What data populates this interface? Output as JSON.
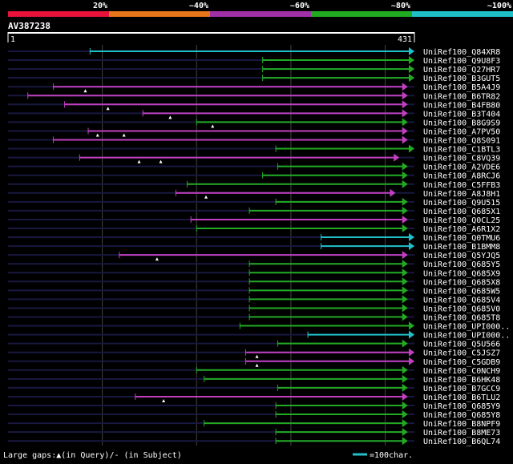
{
  "identity_scale": {
    "labels": [
      "20%",
      "~40%",
      "~60%",
      "~80%",
      "~100%"
    ],
    "colors": [
      "#e8123a",
      "#e8761a",
      "#a030a8",
      "#22aa22",
      "#20c0c8"
    ]
  },
  "query": {
    "id": "AV387238",
    "length": 431,
    "start_label": "1",
    "end_label": "431"
  },
  "color_key": {
    "magenta": "#c040c0",
    "green": "#22aa22",
    "cyan": "#20c0c8",
    "background_line": "#181840",
    "gridline": "#444444"
  },
  "alignments": [
    {
      "label": "UniRef100_Q84XR8",
      "start": 87,
      "end": 431,
      "color": "cyan",
      "marks": []
    },
    {
      "label": "UniRef100_Q9U8F3",
      "start": 270,
      "end": 431,
      "color": "green",
      "marks": []
    },
    {
      "label": "UniRef100_Q27HR7",
      "start": 270,
      "end": 431,
      "color": "green",
      "marks": []
    },
    {
      "label": "UniRef100_B3GUT5",
      "start": 270,
      "end": 431,
      "color": "green",
      "marks": []
    },
    {
      "label": "UniRef100_B5A4J9",
      "start": 48,
      "end": 424,
      "color": "magenta",
      "marks": [
        82
      ]
    },
    {
      "label": "UniRef100_B6TR82",
      "start": 21,
      "end": 424,
      "color": "magenta",
      "marks": []
    },
    {
      "label": "UniRef100_B4FB80",
      "start": 60,
      "end": 424,
      "color": "magenta",
      "marks": [
        106
      ]
    },
    {
      "label": "UniRef100_B3T404",
      "start": 143,
      "end": 424,
      "color": "magenta",
      "marks": [
        172
      ]
    },
    {
      "label": "UniRef100_B8G9S9",
      "start": 200,
      "end": 424,
      "color": "green",
      "marks": [
        217
      ]
    },
    {
      "label": "UniRef100_A7PV50",
      "start": 85,
      "end": 424,
      "color": "magenta",
      "marks": [
        95,
        123
      ]
    },
    {
      "label": "UniRef100_Q8S091",
      "start": 48,
      "end": 424,
      "color": "magenta",
      "marks": []
    },
    {
      "label": "UniRef100_C1BTL3",
      "start": 284,
      "end": 431,
      "color": "green",
      "marks": []
    },
    {
      "label": "UniRef100_C8VQ39",
      "start": 76,
      "end": 415,
      "color": "magenta",
      "marks": [
        139,
        162
      ]
    },
    {
      "label": "UniRef100_A2VDE6",
      "start": 286,
      "end": 424,
      "color": "green",
      "marks": []
    },
    {
      "label": "UniRef100_A8RCJ6",
      "start": 270,
      "end": 424,
      "color": "green",
      "marks": []
    },
    {
      "label": "UniRef100_C5FFB3",
      "start": 190,
      "end": 424,
      "color": "green",
      "marks": []
    },
    {
      "label": "UniRef100_A8J8H1",
      "start": 178,
      "end": 411,
      "color": "magenta",
      "marks": [
        210
      ]
    },
    {
      "label": "UniRef100_Q9U515",
      "start": 284,
      "end": 424,
      "color": "green",
      "marks": []
    },
    {
      "label": "UniRef100_Q685X1",
      "start": 256,
      "end": 424,
      "color": "green",
      "marks": []
    },
    {
      "label": "UniRef100_Q0CL25",
      "start": 194,
      "end": 424,
      "color": "magenta",
      "marks": []
    },
    {
      "label": "UniRef100_A6R1X2",
      "start": 200,
      "end": 424,
      "color": "green",
      "marks": []
    },
    {
      "label": "UniRef100_Q0TMU6",
      "start": 332,
      "end": 431,
      "color": "cyan",
      "marks": []
    },
    {
      "label": "UniRef100_B1BMM8",
      "start": 332,
      "end": 431,
      "color": "cyan",
      "marks": []
    },
    {
      "label": "UniRef100_Q5YJQ5",
      "start": 118,
      "end": 424,
      "color": "magenta",
      "marks": [
        158
      ]
    },
    {
      "label": "UniRef100_Q685Y5",
      "start": 256,
      "end": 424,
      "color": "green",
      "marks": []
    },
    {
      "label": "UniRef100_Q685X9",
      "start": 256,
      "end": 424,
      "color": "green",
      "marks": []
    },
    {
      "label": "UniRef100_Q685X8",
      "start": 256,
      "end": 424,
      "color": "green",
      "marks": []
    },
    {
      "label": "UniRef100_Q685W5",
      "start": 256,
      "end": 424,
      "color": "green",
      "marks": []
    },
    {
      "label": "UniRef100_Q685V4",
      "start": 256,
      "end": 424,
      "color": "green",
      "marks": []
    },
    {
      "label": "UniRef100_Q685V0",
      "start": 256,
      "end": 424,
      "color": "green",
      "marks": []
    },
    {
      "label": "UniRef100_Q685T8",
      "start": 256,
      "end": 424,
      "color": "green",
      "marks": []
    },
    {
      "label": "UniRef100_UPI000..",
      "start": 246,
      "end": 431,
      "color": "green",
      "marks": []
    },
    {
      "label": "UniRef100_UPI000..",
      "start": 318,
      "end": 431,
      "color": "cyan",
      "marks": []
    },
    {
      "label": "UniRef100_Q5U566",
      "start": 286,
      "end": 424,
      "color": "green",
      "marks": []
    },
    {
      "label": "UniRef100_C5JSZ7",
      "start": 252,
      "end": 431,
      "color": "magenta",
      "marks": [
        264
      ]
    },
    {
      "label": "UniRef100_C5GDB9",
      "start": 252,
      "end": 431,
      "color": "magenta",
      "marks": [
        264
      ]
    },
    {
      "label": "UniRef100_C0NCH9",
      "start": 200,
      "end": 424,
      "color": "green",
      "marks": []
    },
    {
      "label": "UniRef100_B6HK48",
      "start": 208,
      "end": 424,
      "color": "green",
      "marks": []
    },
    {
      "label": "UniRef100_B7GCC9",
      "start": 286,
      "end": 424,
      "color": "green",
      "marks": []
    },
    {
      "label": "UniRef100_B6TLU2",
      "start": 135,
      "end": 424,
      "color": "magenta",
      "marks": [
        165
      ]
    },
    {
      "label": "UniRef100_Q685Y9",
      "start": 284,
      "end": 424,
      "color": "green",
      "marks": []
    },
    {
      "label": "UniRef100_Q685Y8",
      "start": 284,
      "end": 424,
      "color": "green",
      "marks": []
    },
    {
      "label": "UniRef100_B8NPF9",
      "start": 208,
      "end": 424,
      "color": "green",
      "marks": []
    },
    {
      "label": "UniRef100_B8ME73",
      "start": 284,
      "end": 424,
      "color": "green",
      "marks": []
    },
    {
      "label": "UniRef100_B6QL74",
      "start": 284,
      "end": 424,
      "color": "green",
      "marks": []
    }
  ],
  "legend": {
    "gaps_text": "Large gaps:▲(in Query)/- (in Subject)",
    "scale_text": "=100char.",
    "scale_color": "#20c0c8"
  }
}
